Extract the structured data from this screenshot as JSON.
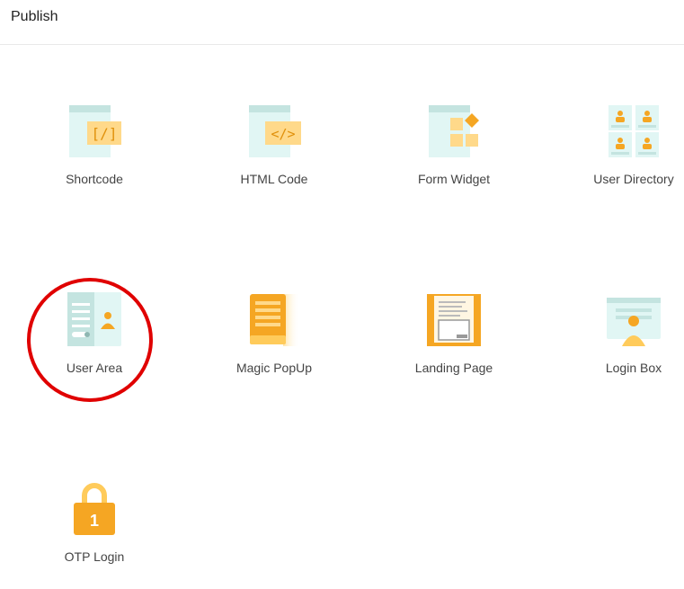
{
  "header": {
    "title": "Publish"
  },
  "items": [
    {
      "label": "Shortcode",
      "icon": "shortcode-icon"
    },
    {
      "label": "HTML Code",
      "icon": "html-code-icon"
    },
    {
      "label": "Form Widget",
      "icon": "form-widget-icon"
    },
    {
      "label": "User Directory",
      "icon": "user-directory-icon"
    },
    {
      "label": "User Area",
      "icon": "user-area-icon",
      "highlighted": true
    },
    {
      "label": "Magic PopUp",
      "icon": "magic-popup-icon"
    },
    {
      "label": "Landing Page",
      "icon": "landing-page-icon"
    },
    {
      "label": "Login Box",
      "icon": "login-box-icon"
    },
    {
      "label": "OTP Login",
      "icon": "otp-login-icon",
      "badge": "1"
    }
  ],
  "colors": {
    "accent": "#f5a623",
    "teal_light": "#e1f6f4",
    "teal": "#c4e4e0",
    "highlight": "#e00000"
  }
}
